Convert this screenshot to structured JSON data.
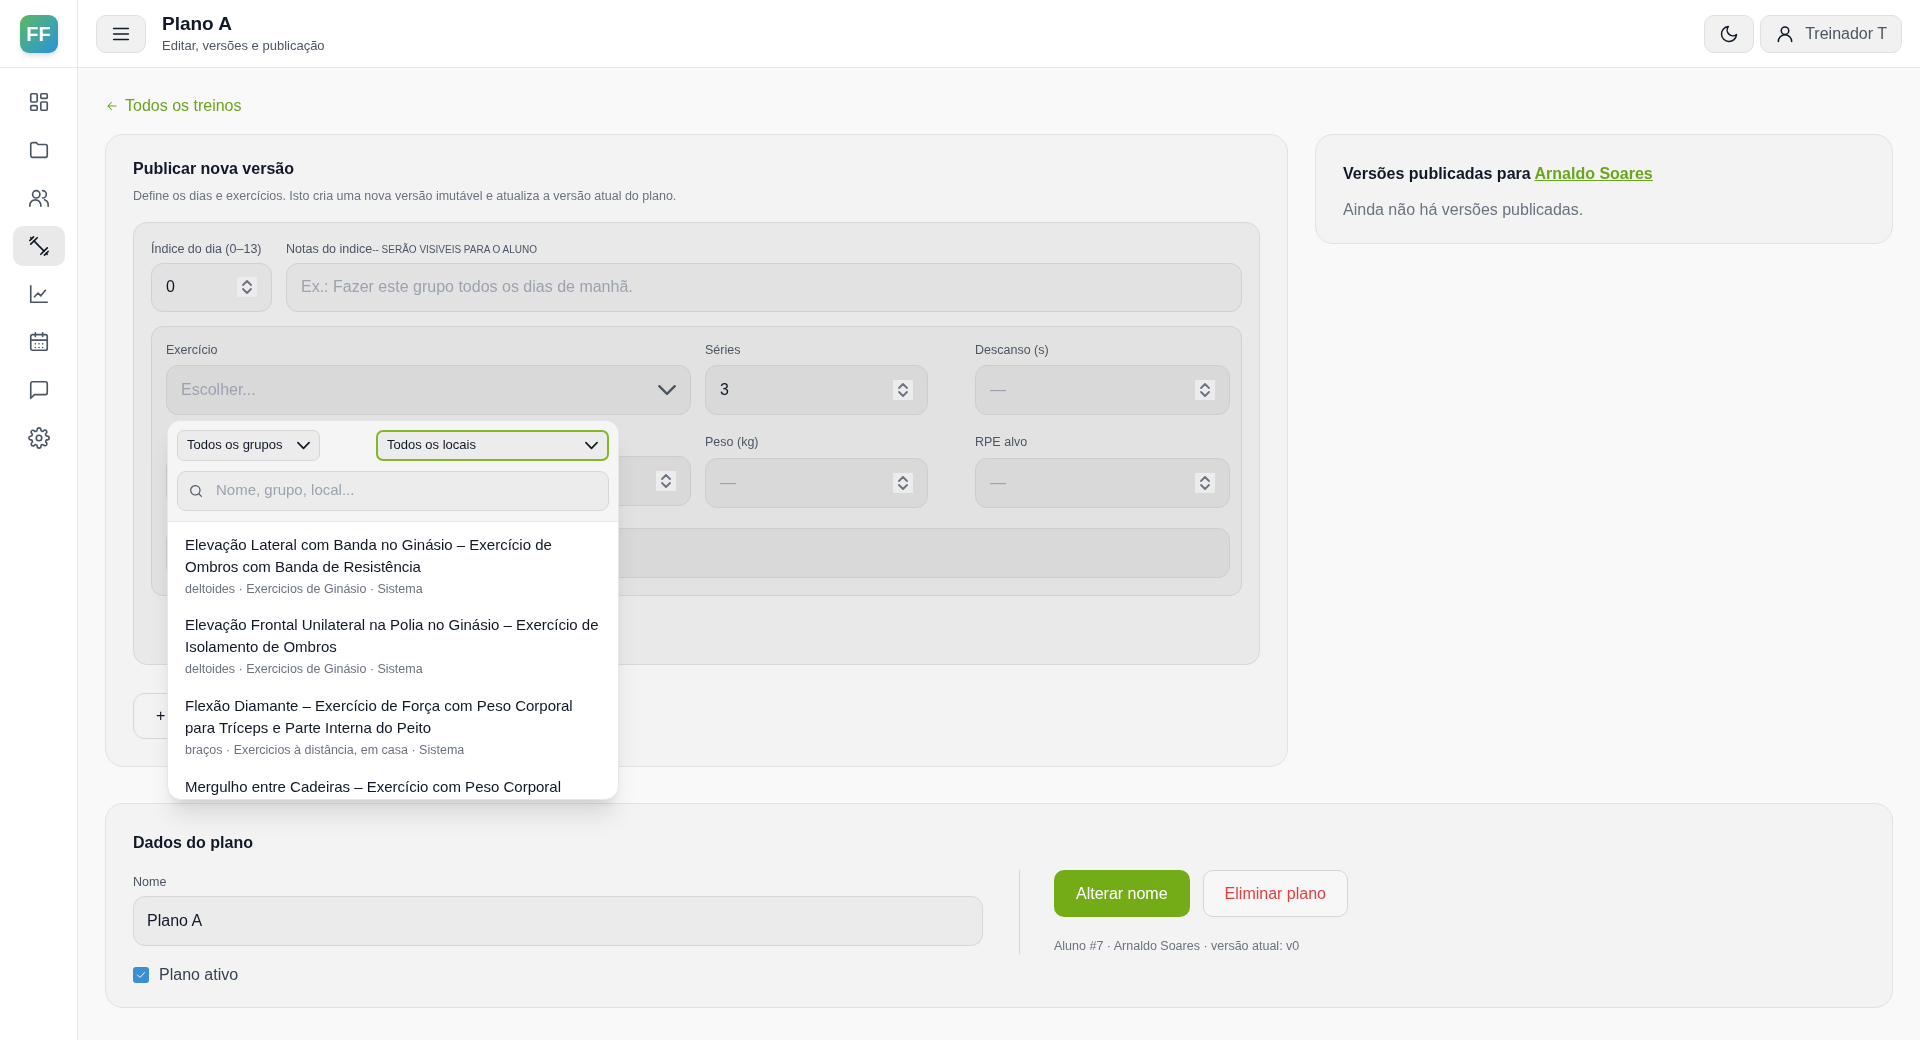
{
  "logo": "FF",
  "sidebar": {
    "items": [
      {
        "kind": "grid",
        "selected": false
      },
      {
        "kind": "folder",
        "selected": false
      },
      {
        "kind": "users",
        "selected": false
      },
      {
        "kind": "dumbbell",
        "selected": true
      },
      {
        "kind": "chart",
        "selected": false
      },
      {
        "kind": "calendar",
        "selected": false
      },
      {
        "kind": "chat",
        "selected": false
      },
      {
        "kind": "settings",
        "selected": false
      }
    ]
  },
  "header": {
    "title": "Plano A",
    "subtitle": "Editar, versões e publicação",
    "user": "Treinador T"
  },
  "back_link": "Todos os treinos",
  "publish": {
    "title": "Publicar nova versão",
    "description": "Define os dias e exercícios. Isto cria uma nova versão imutável e atualiza a versão atual do plano.",
    "day_index": {
      "label": "Índice do dia (0–13)",
      "value": "0"
    },
    "notes": {
      "label": "Notas do indice",
      "label_note": "-- SERÃO VISIVEIS PARA O ALUNO",
      "placeholder": "Ex.: Fazer este grupo todos os dias de manhã."
    },
    "exercise": {
      "label": "Exercício",
      "placeholder": "Escolher..."
    },
    "fields": [
      {
        "label": "Séries",
        "value": "3"
      },
      {
        "label": "Descanso (s)",
        "placeholder": "—"
      },
      {
        "label": "Peso (kg)",
        "placeholder": "—"
      },
      {
        "label": "RPE alvo",
        "placeholder": "—"
      }
    ],
    "add_button": "+"
  },
  "picker": {
    "group_filter": "Todos os grupos",
    "location_filter": {
      "value": "Todos os locais",
      "focused": true
    },
    "search_placeholder": "Nome, grupo, local...",
    "items": [
      {
        "name": "Elevação Lateral com Banda no Ginásio – Exercício de Ombros com Banda de Resistência",
        "meta": "deltoides · Exercicios de Ginásio · Sistema"
      },
      {
        "name": "Elevação Frontal Unilateral na Polia no Ginásio – Exercício de Isolamento de Ombros",
        "meta": "deltoides · Exercicios de Ginásio · Sistema"
      },
      {
        "name": "Flexão Diamante – Exercício de Força com Peso Corporal para Tríceps e Parte Interna do Peito",
        "meta": "braços · Exercicios à distância, em casa · Sistema"
      },
      {
        "name": "Mergulho entre Cadeiras – Exercício com Peso Corporal"
      }
    ]
  },
  "versions": {
    "title": "Versões publicadas para",
    "student": "Arnaldo Soares",
    "empty": "Ainda não há versões publicadas."
  },
  "plan": {
    "title": "Dados do plano",
    "name_label": "Nome",
    "name_value": "Plano A",
    "active": {
      "label": "Plano ativo",
      "checked": true
    },
    "rename_button": "Alterar nome",
    "delete_button": "Eliminar plano",
    "meta": "Aluno #7 · Arnaldo Soares · versão atual: v0"
  }
}
